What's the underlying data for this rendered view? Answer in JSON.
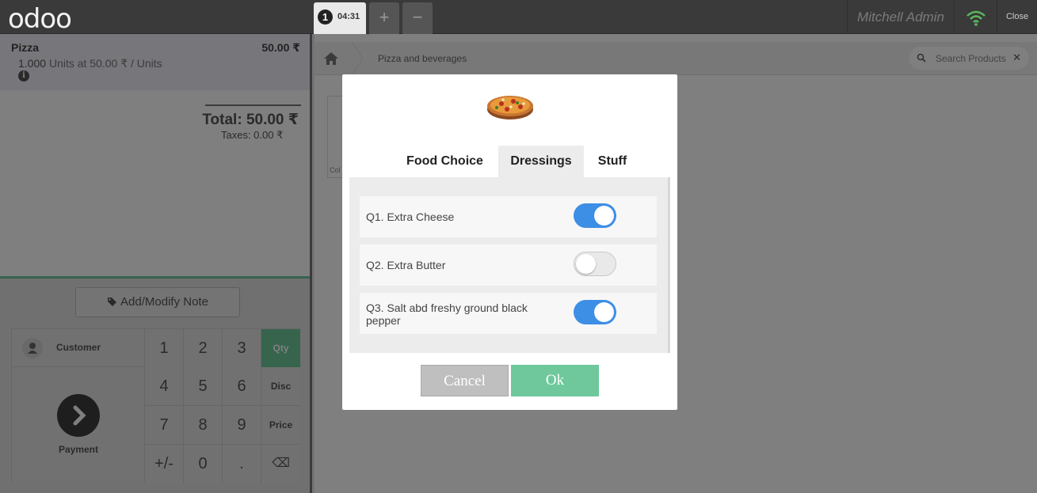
{
  "header": {
    "logo": "odoo",
    "order_number": "1",
    "order_time": "04:31",
    "add_order_label": "+",
    "remove_order_label": "−",
    "user_name": "Mitchell Admin",
    "close_label": "Close"
  },
  "order": {
    "lines": [
      {
        "product": "Pizza",
        "price": "50.00 ₹",
        "qty": "1.000",
        "detail": "Units at 50.00 ₹ / Units"
      }
    ],
    "total": "Total: 50.00 ₹",
    "taxes": "Taxes: 0.00 ₹"
  },
  "controls": {
    "note_button": "Add/Modify Note",
    "customer": "Customer",
    "payment": "Payment",
    "keys": [
      "1",
      "2",
      "3",
      "4",
      "5",
      "6",
      "7",
      "8",
      "9",
      "+/-",
      "0",
      "."
    ],
    "modes": [
      "Qty",
      "Disc",
      "Price"
    ],
    "backspace": "⌫"
  },
  "products": {
    "breadcrumb": "Pizza and beverages",
    "search_placeholder": "Search Products",
    "card_label": "Col"
  },
  "dialog": {
    "tabs": [
      {
        "label": "Food Choice",
        "active": false
      },
      {
        "label": "Dressings",
        "active": true
      },
      {
        "label": "Stuff",
        "active": false
      }
    ],
    "questions": [
      {
        "label": "Q1. Extra Cheese",
        "enabled": true
      },
      {
        "label": "Q2. Extra Butter",
        "enabled": false
      },
      {
        "label": "Q3. Salt abd freshy ground black pepper",
        "enabled": true
      }
    ],
    "cancel_label": "Cancel",
    "ok_label": "Ok"
  },
  "colors": {
    "accent_green": "#6ec89b",
    "toggle_on": "#3d8ee5",
    "wifi": "#5cb85c"
  }
}
